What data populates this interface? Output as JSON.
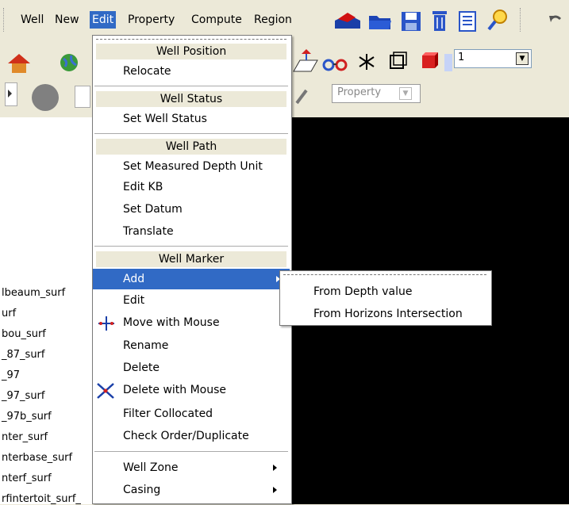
{
  "menubar": {
    "items": [
      "Well",
      "New",
      "Edit",
      "Property",
      "Compute",
      "Region"
    ],
    "active_index": 2
  },
  "toolbar": {
    "property_combo": "Property",
    "count_combo": "1"
  },
  "tree": {
    "items": [
      "lbeaum_surf",
      "urf",
      "bou_surf",
      "_87_surf",
      "_97",
      "_97_surf",
      "_97b_surf",
      "nter_surf",
      "nterbase_surf",
      "nterf_surf",
      "rfintertoit_surf_"
    ]
  },
  "edit_menu": {
    "sections": [
      {
        "header": "Well Position",
        "items": [
          "Relocate"
        ]
      },
      {
        "header": "Well Status",
        "items": [
          "Set Well Status"
        ]
      },
      {
        "header": "Well Path",
        "items": [
          "Set Measured Depth Unit",
          "Edit KB",
          "Set Datum",
          "Translate"
        ]
      },
      {
        "header": "Well Marker",
        "items": [
          "Add",
          "Edit",
          "Move with Mouse",
          "Rename",
          "Delete",
          "Delete with Mouse",
          "Filter Collocated",
          "Check Order/Duplicate"
        ]
      }
    ],
    "trailing_items": [
      "Well Zone",
      "Casing"
    ],
    "highlighted": "Add"
  },
  "add_submenu": {
    "items": [
      "From Depth value",
      "From Horizons Intersection"
    ]
  },
  "colors": {
    "highlight": "#316ac5",
    "menu_header": "#ece9d8",
    "viewport": "#000000"
  }
}
